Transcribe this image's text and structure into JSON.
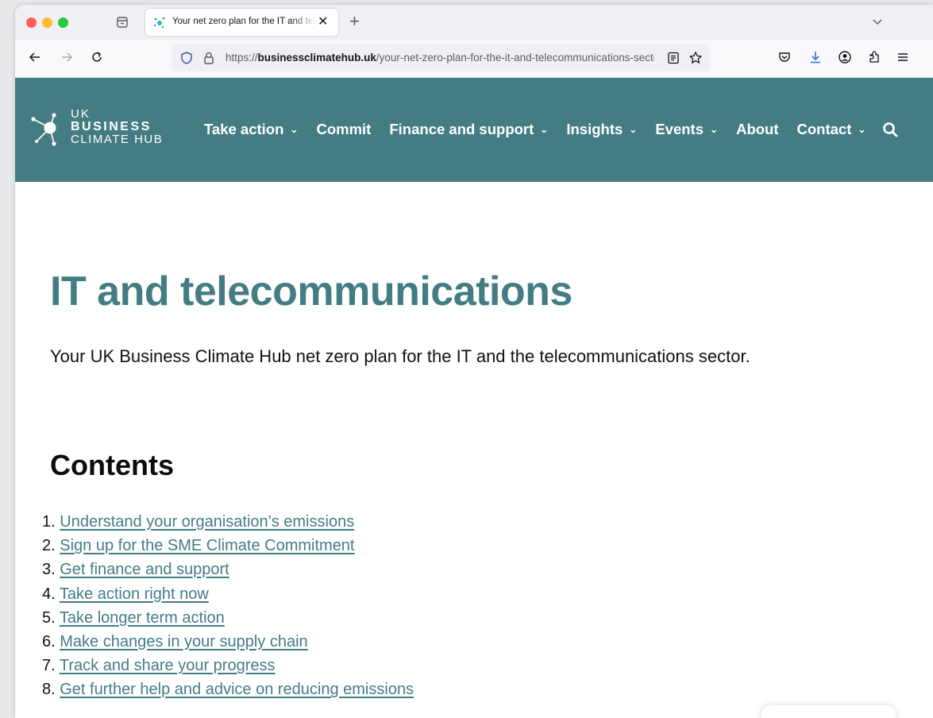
{
  "browser": {
    "tab_title": "Your net zero plan for the IT and telecommunications sector",
    "url_domain": "businessclimatehub.uk",
    "url_scheme": "https://",
    "url_path": "/your-net-zero-plan-for-the-it-and-telecommunications-sector"
  },
  "site": {
    "brand_color": "#437d83",
    "logo": {
      "line1": "UK",
      "line2": "BUSINESS",
      "line3": "CLIMATE HUB"
    },
    "nav": [
      {
        "label": "Take action",
        "dropdown": true
      },
      {
        "label": "Commit",
        "dropdown": false
      },
      {
        "label": "Finance and support",
        "dropdown": true
      },
      {
        "label": "Insights",
        "dropdown": true
      },
      {
        "label": "Events",
        "dropdown": true
      },
      {
        "label": "About",
        "dropdown": false
      },
      {
        "label": "Contact",
        "dropdown": true
      }
    ],
    "nav_caret": "⌄"
  },
  "page": {
    "title": "IT and telecommunications",
    "intro": "Your UK Business Climate Hub net zero plan for the IT and the telecommunications sector.",
    "contents_heading": "Contents",
    "toc": [
      {
        "num": "1.",
        "label": "Understand your organisation’s emissions"
      },
      {
        "num": "2.",
        "label": "Sign up for the SME Climate Commitment"
      },
      {
        "num": "3.",
        "label": "Get finance and support"
      },
      {
        "num": "4.",
        "label": "Take action right now"
      },
      {
        "num": "5.",
        "label": "Take longer term action"
      },
      {
        "num": "6.",
        "label": "Make changes in your supply chain"
      },
      {
        "num": "7.",
        "label": "Track and share your progress"
      },
      {
        "num": "8.",
        "label": "Get further help and advice on reducing emissions"
      }
    ]
  }
}
